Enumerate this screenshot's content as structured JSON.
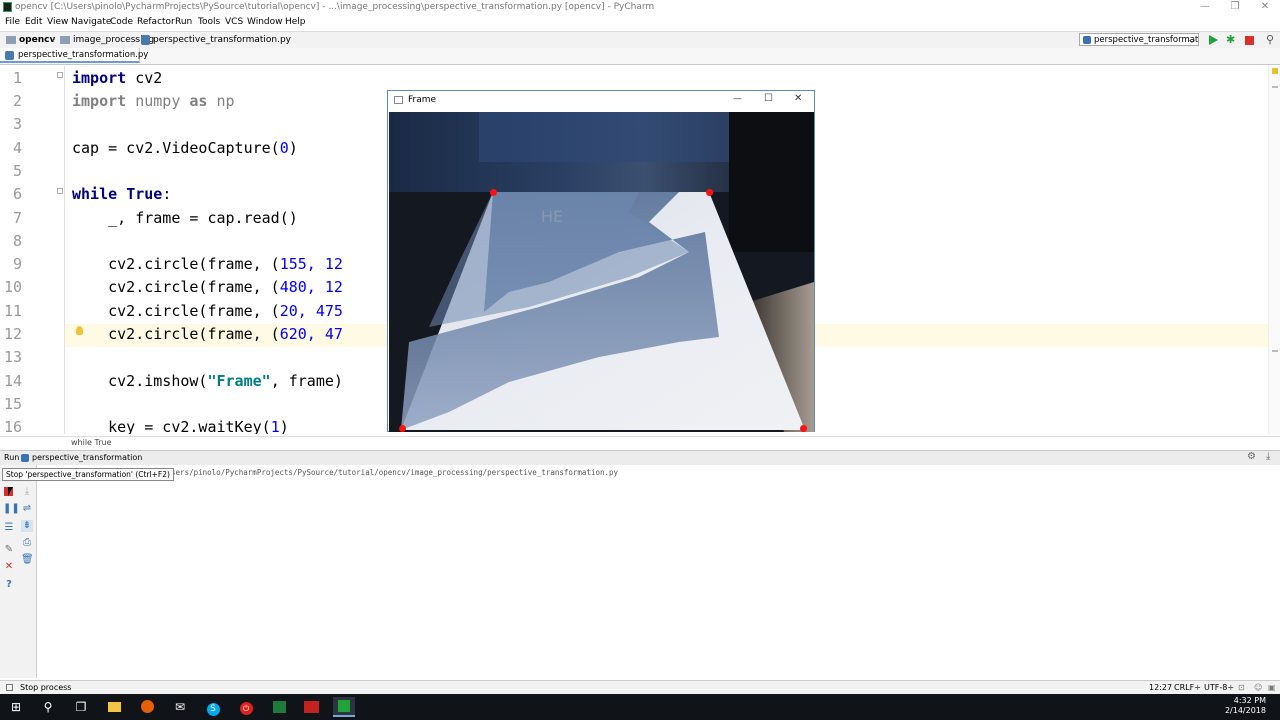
{
  "window": {
    "title": "opencv [C:\\Users\\pinolo\\PycharmProjects\\PySource\\tutorial\\opencv] - ...\\image_processing\\perspective_transformation.py [opencv] - PyCharm",
    "min": "—",
    "max": "❐",
    "close": "✕"
  },
  "menu": [
    "File",
    "Edit",
    "View",
    "Navigate",
    "Code",
    "Refactor",
    "Run",
    "Tools",
    "VCS",
    "Window",
    "Help"
  ],
  "nav": {
    "crumbs": [
      "opencv",
      "image_processing",
      "perspective_transformation.py"
    ],
    "run_config": "perspective_transformation"
  },
  "editor": {
    "tab": "perspective_transformation.py",
    "line_numbers": [
      "1",
      "2",
      "3",
      "4",
      "5",
      "6",
      "7",
      "8",
      "9",
      "10",
      "11",
      "12",
      "13",
      "14",
      "15",
      "16"
    ],
    "lines": {
      "l1a": "import",
      "l1b": " cv2",
      "l2a": "import",
      "l2b": " numpy ",
      "l2c": "as",
      "l2d": " np",
      "l4": "cap = cv2.VideoCapture(",
      "l4n": "0",
      "l4e": ")",
      "l6a": "while",
      "l6b": " ",
      "l6c": "True",
      "l6d": ":",
      "l7": "    _, frame = cap.read()",
      "l9": "    cv2.circle(frame, (",
      "l9n": "155, 12",
      "l10": "    cv2.circle(frame, (",
      "l10n": "480, 12",
      "l11": "    cv2.circle(frame, (",
      "l11n": "20, 475",
      "l12": "    cv2.circle(frame, (",
      "l12n": "620, 47",
      "l14a": "    cv2.imshow(",
      "l14s": "\"Frame\"",
      "l14b": ", frame)",
      "l16": "    key = cv2.waitKey(",
      "l16n": "1",
      "l16e": ")"
    },
    "breadcrumb": "while True"
  },
  "frame_window": {
    "title": "Frame",
    "min": "—",
    "max": "☐",
    "close": "✕",
    "paper_text": "HE"
  },
  "run": {
    "label": "Run",
    "config": "perspective_transformation",
    "tooltip": "Stop 'perspective_transformation' (Ctrl+F2)",
    "console_path": "/Users/pinolo/PycharmProjects/PySource/tutorial/opencv/image_processing/perspective_transformation.py"
  },
  "status": {
    "left": "Stop process",
    "position": "12:27",
    "line_sep": "CRLF÷",
    "encoding": "UTF-8÷"
  },
  "taskbar": {
    "time": "4:32 PM",
    "date": "2/14/2018"
  },
  "colors": {
    "keyword": "#000080",
    "number": "#0000ff",
    "string": "#008080",
    "run_green": "#21a33a",
    "stop_red": "#d9302c",
    "dot_red": "#ff1010"
  }
}
